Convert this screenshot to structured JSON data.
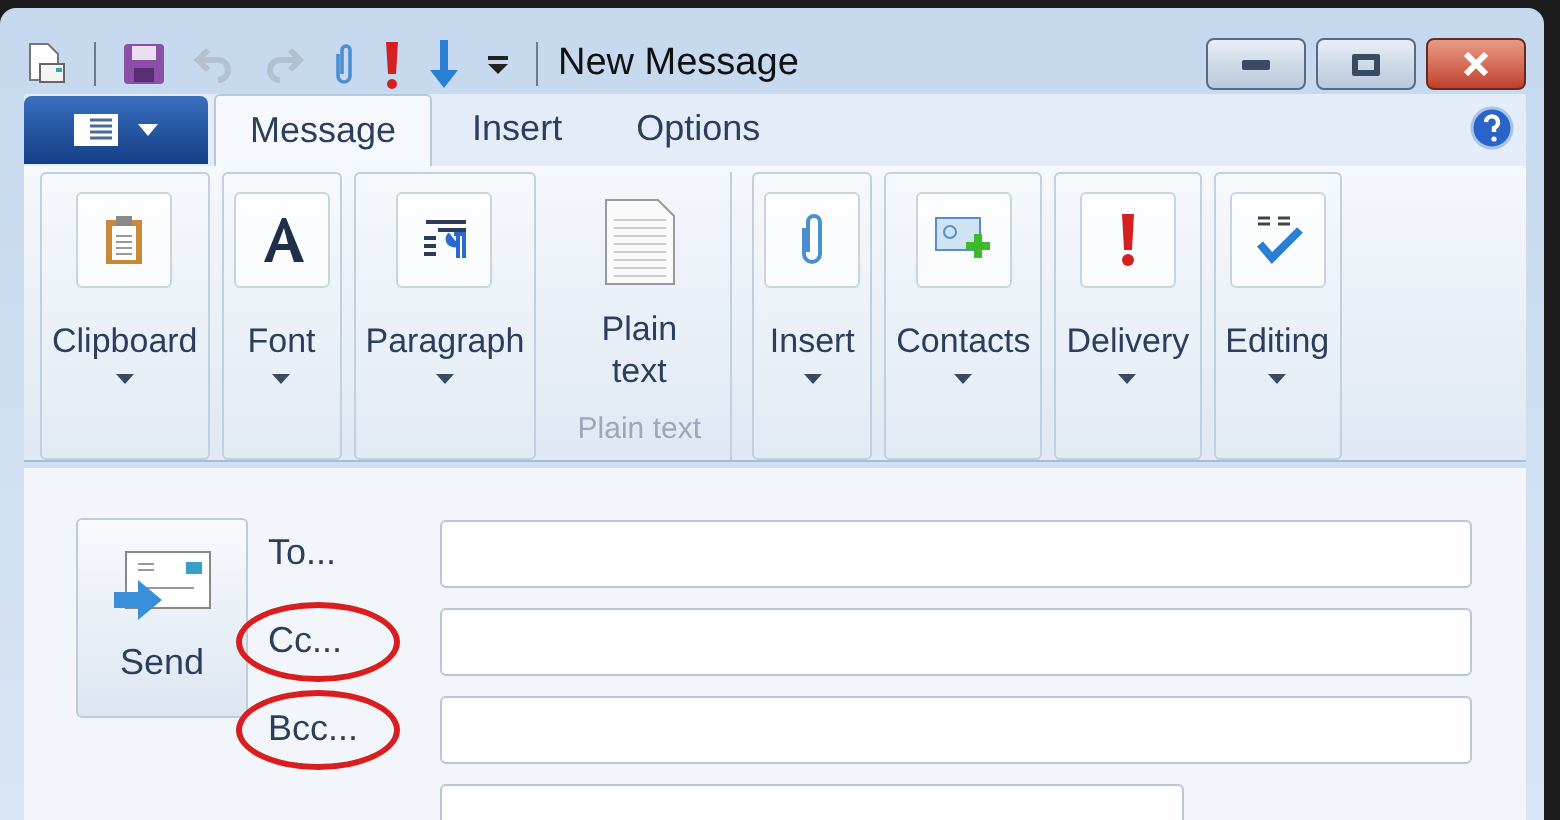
{
  "window": {
    "title": "New Message"
  },
  "quick_access": [
    {
      "disabled": false
    },
    {
      "disabled": false
    },
    {
      "disabled": true
    },
    {
      "disabled": true
    },
    {
      "disabled": false
    },
    {
      "disabled": false
    },
    {
      "disabled": false
    },
    {
      "disabled": false
    }
  ],
  "tabs": [
    {
      "label": "Message",
      "selected": true
    },
    {
      "label": "Insert",
      "selected": false
    },
    {
      "label": "Options",
      "selected": false
    }
  ],
  "ribbon": [
    {
      "kind": "dropdown",
      "label": "Clipboard"
    },
    {
      "kind": "dropdown",
      "label": "Font"
    },
    {
      "kind": "dropdown",
      "label": "Paragraph"
    },
    {
      "kind": "large",
      "label": "Plain text",
      "group_label": "Plain text"
    },
    {
      "kind": "dropdown",
      "label": "Insert"
    },
    {
      "kind": "dropdown",
      "label": "Contacts"
    },
    {
      "kind": "dropdown",
      "label": "Delivery"
    },
    {
      "kind": "dropdown",
      "label": "Editing"
    }
  ],
  "send": {
    "label": "Send"
  },
  "fields": [
    {
      "label": "To...",
      "circled": false
    },
    {
      "label": "Cc...",
      "circled": true
    },
    {
      "label": "Bcc...",
      "circled": true
    },
    {
      "circled": false
    }
  ]
}
